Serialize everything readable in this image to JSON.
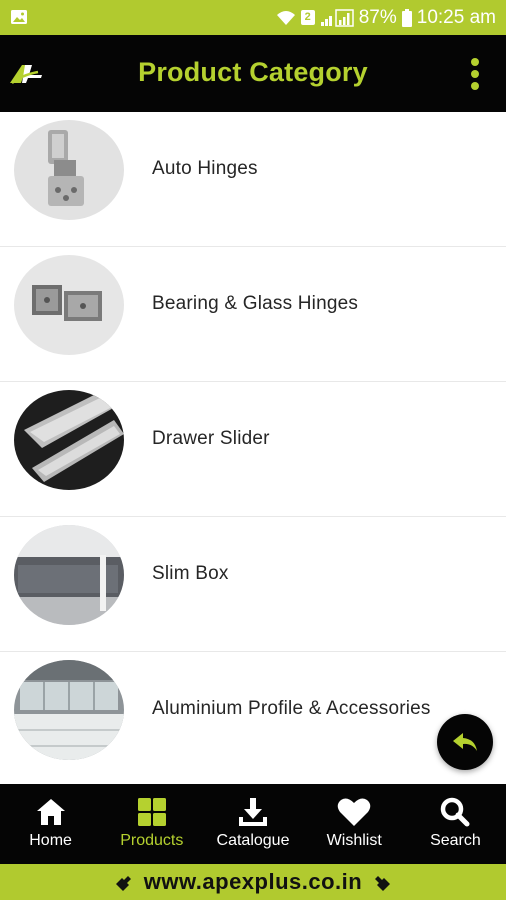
{
  "status_bar": {
    "sim_badge": "2",
    "battery": "87%",
    "time": "10:25 am",
    "icons": [
      "image-icon",
      "wifi-icon",
      "signal-icon",
      "battery-icon"
    ]
  },
  "app_bar": {
    "title": "Product Category",
    "logo": "apex-logo",
    "menu_icon": "more-vertical-icon"
  },
  "categories": [
    {
      "label": "Auto Hinges"
    },
    {
      "label": "Bearing & Glass Hinges"
    },
    {
      "label": "Drawer Slider"
    },
    {
      "label": "Slim Box"
    },
    {
      "label": "Aluminium Profile & Accessories"
    }
  ],
  "fab": {
    "icon": "reply-icon"
  },
  "bottom_nav": [
    {
      "label": "Home",
      "icon": "home-icon"
    },
    {
      "label": "Products",
      "icon": "grid-icon",
      "active": true
    },
    {
      "label": "Catalogue",
      "icon": "download-icon"
    },
    {
      "label": "Wishlist",
      "icon": "heart-icon"
    },
    {
      "label": "Search",
      "icon": "search-icon"
    }
  ],
  "footer": {
    "url": "www.apexplus.co.in"
  },
  "colors": {
    "accent": "#b5d12f",
    "status_bar": "#b1ca2f",
    "bar_bg": "#050505"
  }
}
